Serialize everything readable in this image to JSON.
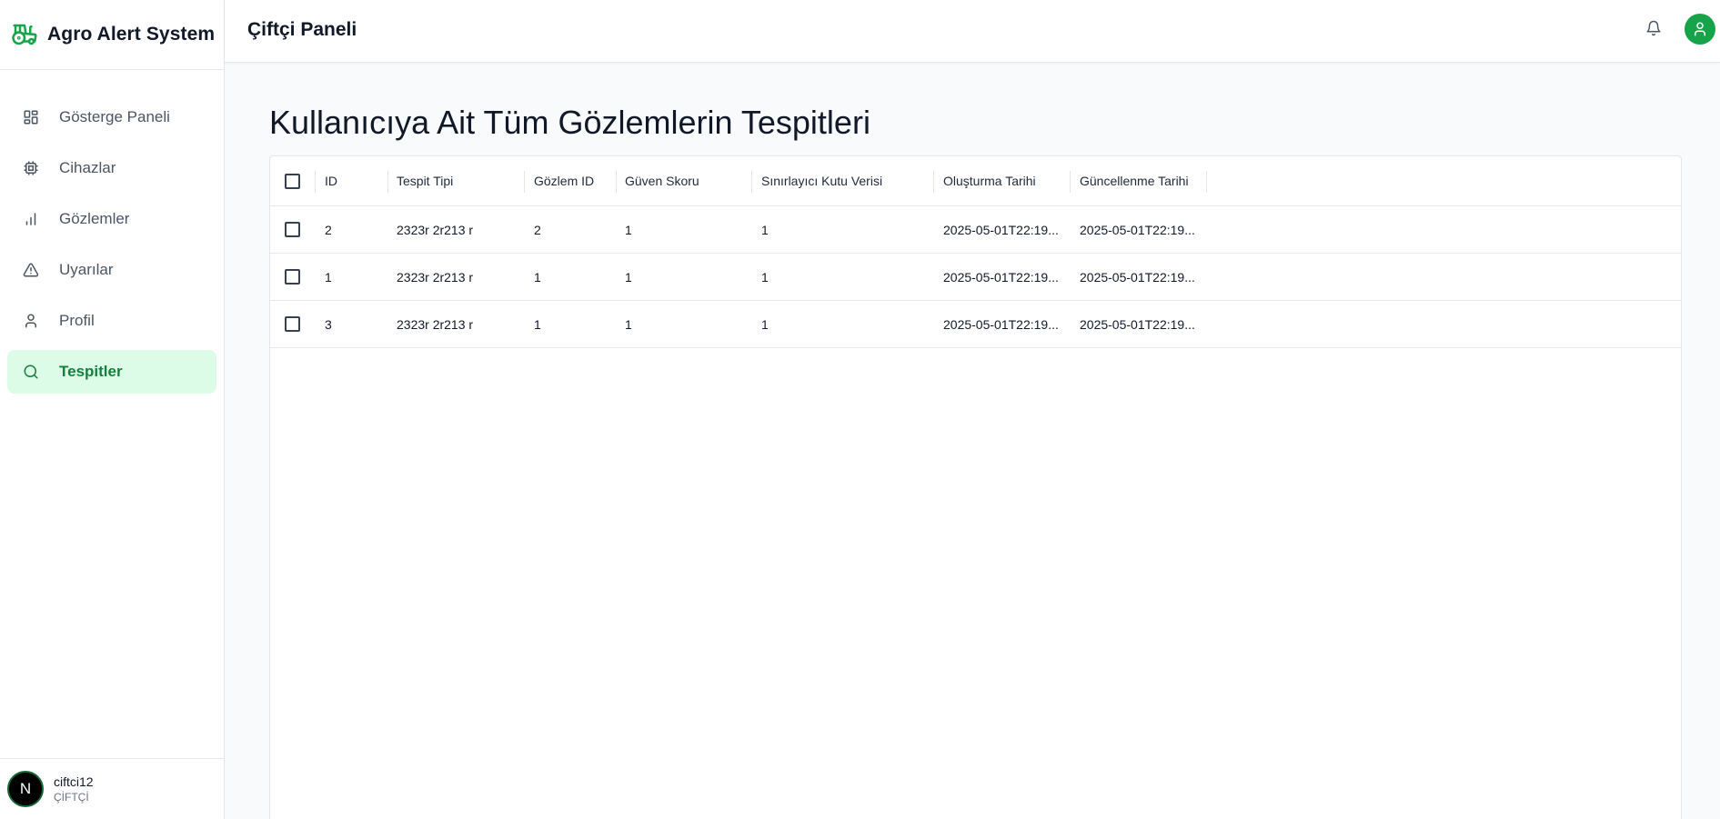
{
  "brand": {
    "title": "Agro Alert System",
    "icon": "tractor-icon"
  },
  "sidebar": {
    "items": [
      {
        "label": "Gösterge Paneli",
        "icon": "dashboard-grid-icon"
      },
      {
        "label": "Cihazlar",
        "icon": "chip-icon"
      },
      {
        "label": "Gözlemler",
        "icon": "bar-chart-icon"
      },
      {
        "label": "Uyarılar",
        "icon": "warning-triangle-icon"
      },
      {
        "label": "Profil",
        "icon": "user-icon"
      },
      {
        "label": "Tespitler",
        "icon": "search-icon",
        "active": true
      }
    ]
  },
  "user": {
    "initial": "N",
    "name": "ciftci12",
    "role": "ÇİFTÇİ"
  },
  "header": {
    "title": "Çiftçi Paneli",
    "bell_icon": "bell-icon",
    "profile_icon": "user-circle-icon"
  },
  "main": {
    "heading": "Kullanıcıya Ait Tüm Gözlemlerin Tespitleri"
  },
  "table": {
    "columns": [
      "ID",
      "Tespit Tipi",
      "Gözlem ID",
      "Güven Skoru",
      "Sınırlayıcı Kutu Verisi",
      "Oluşturma Tarihi",
      "Güncellenme Tarihi"
    ],
    "rows": [
      [
        "2",
        "2323r 2r213 r",
        "2",
        "1",
        "1",
        "2025-05-01T22:19...",
        "2025-05-01T22:19..."
      ],
      [
        "1",
        "2323r 2r213 r",
        "1",
        "1",
        "1",
        "2025-05-01T22:19...",
        "2025-05-01T22:19..."
      ],
      [
        "3",
        "2323r 2r213 r",
        "1",
        "1",
        "1",
        "2025-05-01T22:19...",
        "2025-05-01T22:19..."
      ]
    ]
  },
  "colors": {
    "accent": "#16a34a",
    "active_bg": "#dcfce7",
    "active_text": "#15803d"
  }
}
